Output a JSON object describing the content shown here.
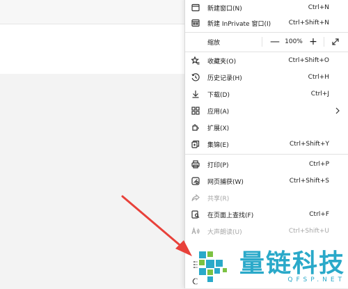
{
  "menu": {
    "new_window": {
      "label": "新建窗口(N)",
      "shortcut": "Ctrl+N"
    },
    "new_inprivate": {
      "label": "新建 InPrivate 窗口(I)",
      "shortcut": "Ctrl+Shift+N"
    },
    "zoom": {
      "label": "缩放",
      "minus": "—",
      "value": "100%",
      "plus": "+"
    },
    "favorites": {
      "label": "收藏夹(O)",
      "shortcut": "Ctrl+Shift+O"
    },
    "history": {
      "label": "历史记录(H)",
      "shortcut": "Ctrl+H"
    },
    "downloads": {
      "label": "下载(D)",
      "shortcut": "Ctrl+J"
    },
    "apps": {
      "label": "应用(A)"
    },
    "extensions": {
      "label": "扩展(X)"
    },
    "collections": {
      "label": "集锦(E)",
      "shortcut": "Ctrl+Shift+Y"
    },
    "print": {
      "label": "打印(P)",
      "shortcut": "Ctrl+P"
    },
    "web_capture": {
      "label": "网页捕获(W)",
      "shortcut": "Ctrl+Shift+S"
    },
    "share": {
      "label": "共享(R)"
    },
    "find": {
      "label": "在页面上查找(F)",
      "shortcut": "Ctrl+F"
    },
    "read_aloud": {
      "label": "大声朗读(U)",
      "shortcut": "Ctrl+Shift+U"
    }
  },
  "watermark": {
    "title": "量链科技",
    "url": "QFSP.NET"
  },
  "colors": {
    "arrow": "#e8413a",
    "watermark": "#2aa9c9"
  }
}
